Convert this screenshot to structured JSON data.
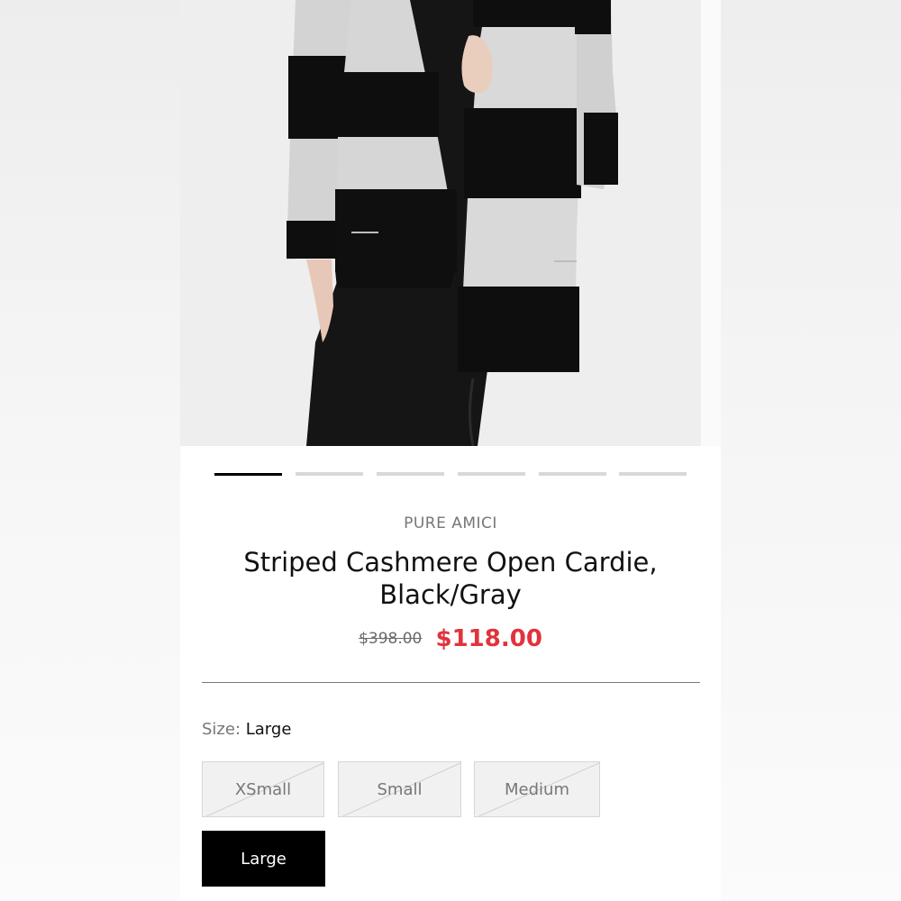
{
  "product": {
    "brand": "PURE AMICI",
    "title": "Striped Cashmere Open Cardie, Black/Gray",
    "original_price": "$398.00",
    "sale_price": "$118.00"
  },
  "carousel": {
    "count": 6,
    "active_index": 0
  },
  "size": {
    "label": "Size:",
    "selected": "Large",
    "options": [
      {
        "label": "XSmall",
        "available": false
      },
      {
        "label": "Small",
        "available": false
      },
      {
        "label": "Medium",
        "available": false
      },
      {
        "label": "Large",
        "available": true,
        "selected": true
      }
    ]
  },
  "colors": {
    "sale": "#e1333c",
    "selected_bg": "#000000",
    "unavailable_bg": "#f1f1f1"
  }
}
